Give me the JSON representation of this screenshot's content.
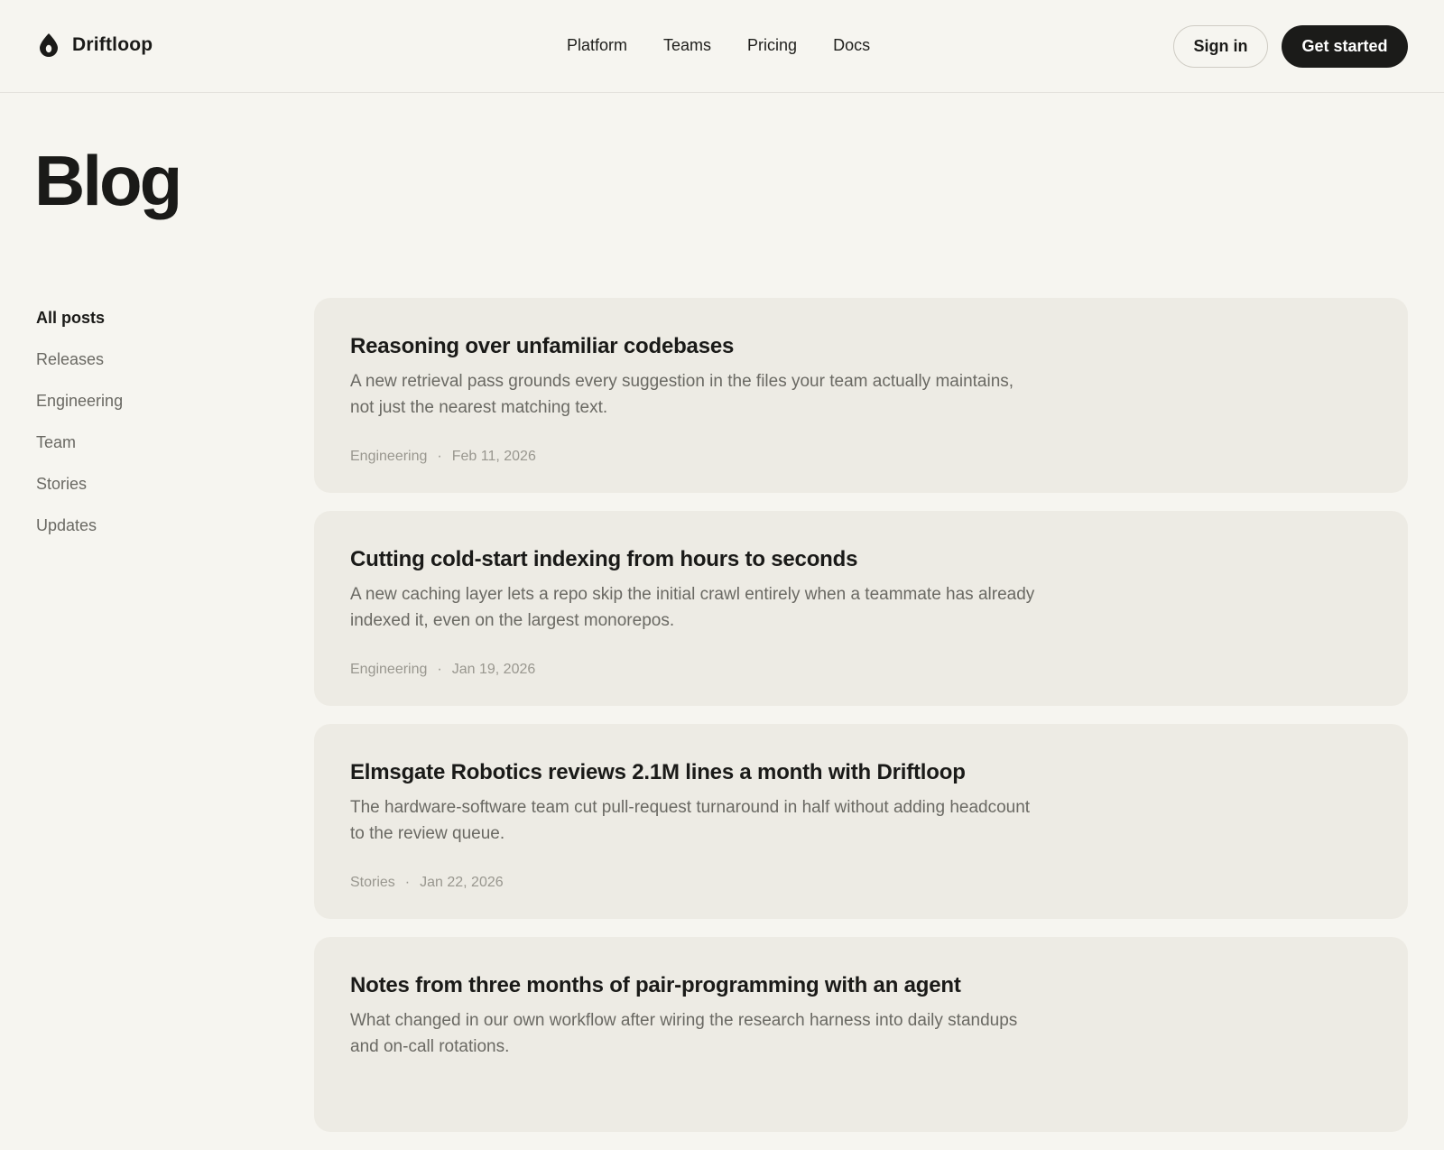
{
  "brand": {
    "name": "Driftloop",
    "icon": "droplet-icon"
  },
  "nav": {
    "links": [
      "Platform",
      "Teams",
      "Pricing",
      "Docs"
    ]
  },
  "actions": {
    "sign_in": "Sign in",
    "get_started": "Get started"
  },
  "page": {
    "title": "Blog"
  },
  "sidebar": {
    "items": [
      {
        "label": "All posts",
        "active": true
      },
      {
        "label": "Releases",
        "active": false
      },
      {
        "label": "Engineering",
        "active": false
      },
      {
        "label": "Team",
        "active": false
      },
      {
        "label": "Stories",
        "active": false
      },
      {
        "label": "Updates",
        "active": false
      }
    ]
  },
  "posts": [
    {
      "title": "Reasoning over unfamiliar codebases",
      "excerpt": "A new retrieval pass grounds every suggestion in the files your team actually maintains, not just the nearest matching text.",
      "category": "Engineering",
      "separator": "·",
      "date": "Feb 11, 2026"
    },
    {
      "title": "Cutting cold-start indexing from hours to seconds",
      "excerpt": "A new caching layer lets a repo skip the initial crawl entirely when a teammate has already indexed it, even on the largest monorepos.",
      "category": "Engineering",
      "separator": "·",
      "date": "Jan 19, 2026"
    },
    {
      "title": "Elmsgate Robotics reviews 2.1M lines a month with Driftloop",
      "excerpt": "The hardware-software team cut pull-request turnaround in half without adding headcount to the review queue.",
      "category": "Stories",
      "separator": "·",
      "date": "Jan 22, 2026"
    },
    {
      "title": "Notes from three months of pair-programming with an agent",
      "excerpt": "What changed in our own workflow after wiring the research harness into daily standups and on-call rotations.",
      "category": "",
      "separator": "",
      "date": ""
    }
  ],
  "colors": {
    "background": "#f6f5f0",
    "card": "#edebe4",
    "primary_button": "#1b1b19",
    "muted_text": "#6a6963"
  }
}
